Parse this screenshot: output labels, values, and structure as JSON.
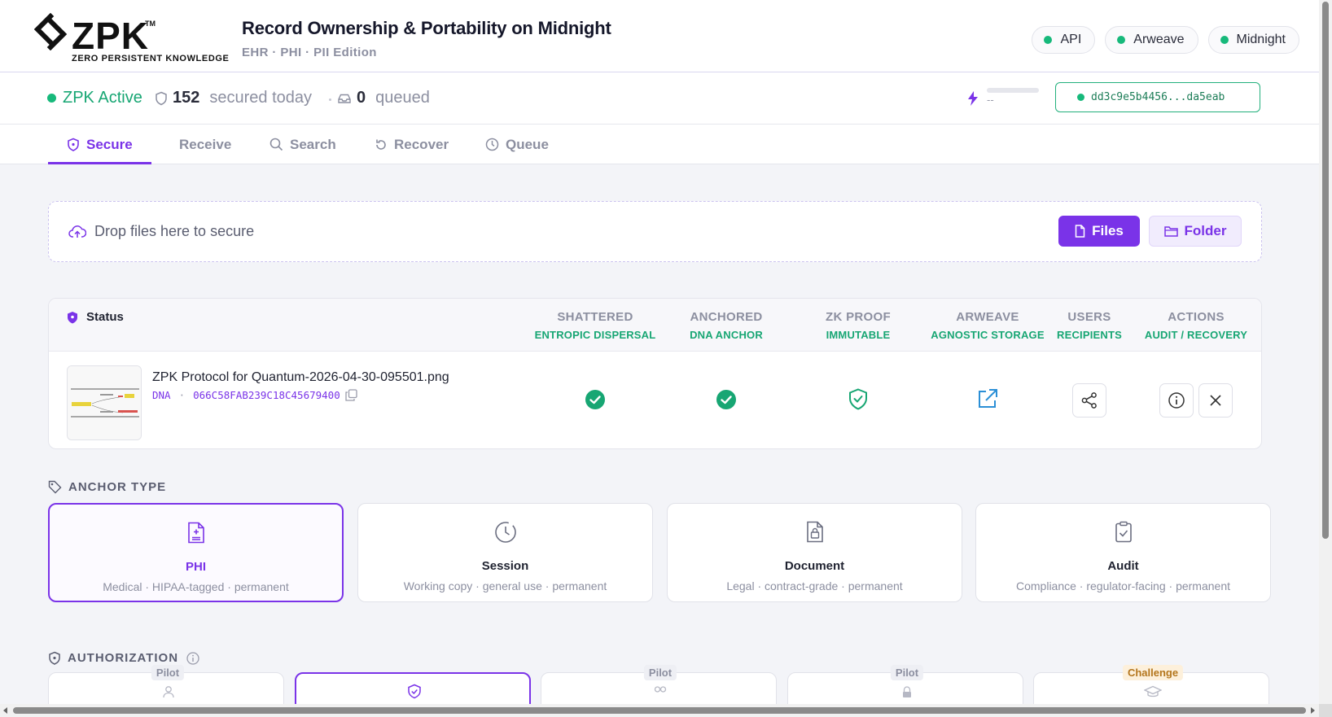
{
  "brand": {
    "wordmark": "ZPK",
    "tm": "TM",
    "tagline": "ZERO PERSISTENT KNOWLEDGE"
  },
  "header": {
    "title": "Record Ownership & Portability on Midnight",
    "subtitle": "EHR · PHI · PII Edition",
    "pills": [
      {
        "label": "API",
        "status_color": "#17b97b"
      },
      {
        "label": "Arweave",
        "status_color": "#17b97b"
      },
      {
        "label": "Midnight",
        "status_color": "#17b97b"
      }
    ]
  },
  "status_bar": {
    "active_label": "ZPK Active",
    "secured_count": "152",
    "secured_label": "secured today",
    "queued_count": "0",
    "queued_label": "queued",
    "progress_label": "--",
    "progress_fraction": 0,
    "hash": "dd3c9e5b4456...da5eab"
  },
  "tabs": [
    {
      "label": "Secure",
      "icon": "shield-icon",
      "active": true
    },
    {
      "label": "Receive",
      "icon": "",
      "active": false
    },
    {
      "label": "Search",
      "icon": "search-icon",
      "active": false
    },
    {
      "label": "Recover",
      "icon": "refresh-icon",
      "active": false
    },
    {
      "label": "Queue",
      "icon": "clock-icon",
      "active": false
    }
  ],
  "dropzone": {
    "text": "Drop files here to secure",
    "files_label": "Files",
    "folder_label": "Folder"
  },
  "status_table": {
    "title": "Status",
    "columns": [
      {
        "title": "SHATTERED",
        "sub": "ENTROPIC DISPERSAL"
      },
      {
        "title": "ANCHORED",
        "sub": "DNA ANCHOR"
      },
      {
        "title": "ZK PROOF",
        "sub": "IMMUTABLE"
      },
      {
        "title": "ARWEAVE",
        "sub": "AGNOSTIC STORAGE"
      },
      {
        "title": "USERS",
        "sub": "RECIPIENTS"
      },
      {
        "title": "ACTIONS",
        "sub": "AUDIT / RECOVERY"
      }
    ],
    "rows": [
      {
        "file_name": "ZPK Protocol for Quantum-2026-04-30-095501.png",
        "dna_label": "DNA",
        "dna_sep": "·",
        "dna_value": "066C58FAB239C18C45679400",
        "shattered": "check-icon",
        "anchored": "check-icon",
        "zk_proof": "shield-check-icon",
        "arweave": "external-link-icon"
      }
    ]
  },
  "anchor_type": {
    "label": "ANCHOR TYPE",
    "options": [
      {
        "name": "PHI",
        "desc": "Medical · HIPAA-tagged · permanent",
        "selected": true,
        "icon": "medical-file-icon"
      },
      {
        "name": "Session",
        "desc": "Working copy · general use · permanent",
        "selected": false,
        "icon": "clock-icon"
      },
      {
        "name": "Document",
        "desc": "Legal · contract-grade · permanent",
        "selected": false,
        "icon": "lock-file-icon"
      },
      {
        "name": "Audit",
        "desc": "Compliance · regulator-facing · permanent",
        "selected": false,
        "icon": "clipboard-check-icon"
      }
    ]
  },
  "authorization": {
    "label": "AUTHORIZATION",
    "options": [
      {
        "badge": "Pilot",
        "selected": false,
        "icon": "user-icon"
      },
      {
        "badge": "",
        "selected": true,
        "icon": "shield-check-icon"
      },
      {
        "badge": "Pilot",
        "selected": false,
        "icon": "users-icon"
      },
      {
        "badge": "Pilot",
        "selected": false,
        "icon": "lock-icon"
      },
      {
        "badge": "Challenge",
        "selected": false,
        "icon": "graduation-cap-icon"
      }
    ]
  },
  "colors": {
    "accent": "#7a33e8",
    "success": "#17a673",
    "link": "#2b8fd6"
  }
}
